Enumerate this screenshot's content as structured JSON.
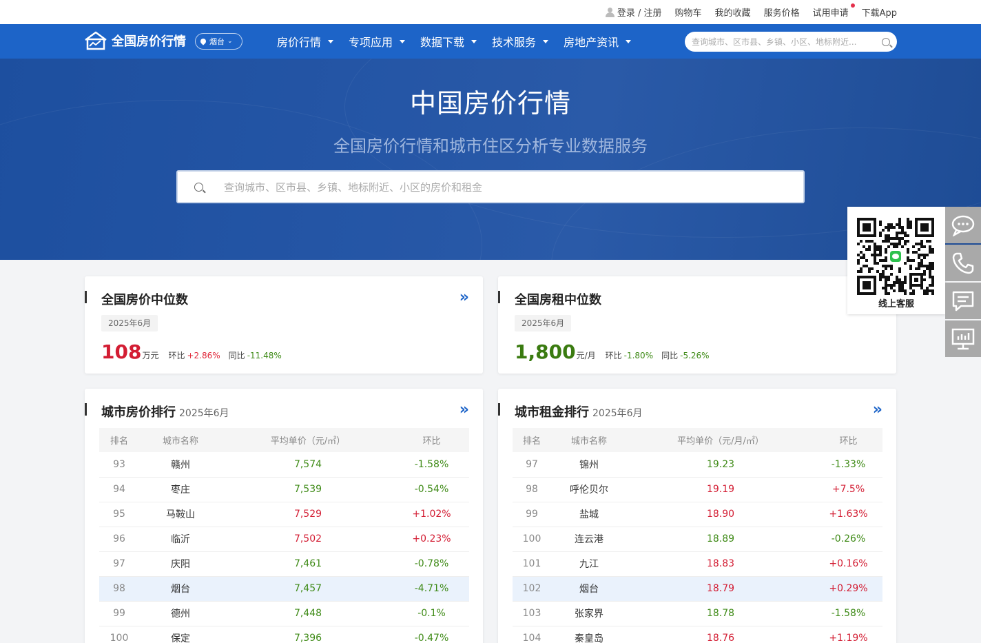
{
  "topbar": {
    "login": "登录 / 注册",
    "cart": "购物车",
    "favorites": "我的收藏",
    "pricing": "服务价格",
    "trial": "试用申请",
    "download": "下载App"
  },
  "nav": {
    "logo_text": "全国房价行情",
    "city": "烟台",
    "menu": [
      {
        "label": "房价行情"
      },
      {
        "label": "专项应用"
      },
      {
        "label": "数据下载"
      },
      {
        "label": "技术服务"
      },
      {
        "label": "房地产资讯"
      }
    ],
    "search_placeholder": "查询城市、区市县、乡镇、小区、地标附近..."
  },
  "hero": {
    "title": "中国房价行情",
    "subtitle": "全国房价行情和城市住区分析专业数据服务",
    "search_placeholder": "查询城市、区市县、乡镇、地标附近、小区的房价和租金"
  },
  "price_median": {
    "title": "全国房价中位数",
    "date": "2025年6月",
    "value": "108",
    "unit": "万元",
    "mom_label": "环比",
    "mom": "+2.86%",
    "yoy_label": "同比",
    "yoy": "-11.48%"
  },
  "rent_median": {
    "title": "全国房租中位数",
    "date": "2025年6月",
    "value": "1,800",
    "unit": "元/月",
    "mom_label": "环比",
    "mom": "-1.80%",
    "yoy_label": "同比",
    "yoy": "-5.26%"
  },
  "price_rank": {
    "title": "城市房价排行",
    "date": "2025年6月",
    "headers": [
      "排名",
      "城市名称",
      "平均单价（元/㎡）",
      "环比"
    ],
    "rows": [
      {
        "rank": "93",
        "city": "赣州",
        "price": "7,574",
        "change": "-1.58%"
      },
      {
        "rank": "94",
        "city": "枣庄",
        "price": "7,539",
        "change": "-0.54%"
      },
      {
        "rank": "95",
        "city": "马鞍山",
        "price": "7,529",
        "change": "+1.02%"
      },
      {
        "rank": "96",
        "city": "临沂",
        "price": "7,502",
        "change": "+0.23%"
      },
      {
        "rank": "97",
        "city": "庆阳",
        "price": "7,461",
        "change": "-0.78%"
      },
      {
        "rank": "98",
        "city": "烟台",
        "price": "7,457",
        "change": "-4.71%"
      },
      {
        "rank": "99",
        "city": "德州",
        "price": "7,448",
        "change": "-0.1%"
      },
      {
        "rank": "100",
        "city": "保定",
        "price": "7,396",
        "change": "-0.47%"
      }
    ]
  },
  "rent_rank": {
    "title": "城市租金排行",
    "date": "2025年6月",
    "headers": [
      "排名",
      "城市名称",
      "平均单价（元/月/㎡）",
      "环比"
    ],
    "rows": [
      {
        "rank": "97",
        "city": "锦州",
        "price": "19.23",
        "change": "-1.33%"
      },
      {
        "rank": "98",
        "city": "呼伦贝尔",
        "price": "19.19",
        "change": "+7.5%"
      },
      {
        "rank": "99",
        "city": "盐城",
        "price": "18.90",
        "change": "+1.63%"
      },
      {
        "rank": "100",
        "city": "连云港",
        "price": "18.89",
        "change": "-0.26%"
      },
      {
        "rank": "101",
        "city": "九江",
        "price": "18.83",
        "change": "+0.16%"
      },
      {
        "rank": "102",
        "city": "烟台",
        "price": "18.79",
        "change": "+0.29%"
      },
      {
        "rank": "103",
        "city": "张家界",
        "price": "18.78",
        "change": "-1.58%"
      },
      {
        "rank": "104",
        "city": "秦皇岛",
        "price": "18.76",
        "change": "+1.19%"
      }
    ]
  },
  "sidebar": {
    "qr_label": "线上客服",
    "buttons": [
      {
        "icon": "chat-bubble-icon"
      },
      {
        "icon": "phone-icon"
      },
      {
        "icon": "message-icon"
      },
      {
        "icon": "monitor-chart-icon"
      }
    ]
  },
  "colors": {
    "brand_blue": "#1d64c8",
    "up_red": "#d31d33",
    "down_green": "#3e8a16",
    "highlight_row": "#eaf2fc"
  }
}
